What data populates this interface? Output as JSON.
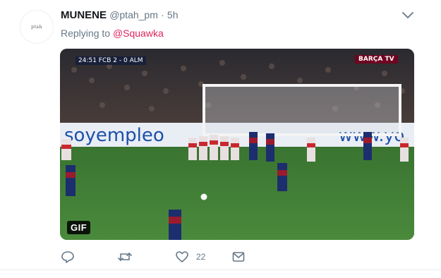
{
  "tweet": {
    "author_name": "MUNENE",
    "author_handle": "@ptah_pm",
    "separator": "·",
    "time": "5h",
    "avatar_text": "ptah",
    "replying_prefix": "Replying to",
    "replying_to": "@Squawka"
  },
  "media": {
    "badge": "GIF",
    "scorebug": "24:51  FCB 2 - 0 ALM",
    "channel_logo": "BARÇA TV",
    "ad_left": "soyempleo",
    "ad_right": "www.yo"
  },
  "actions": {
    "reply_icon": "reply-icon",
    "retweet_icon": "retweet-icon",
    "like_icon": "heart-icon",
    "like_count": "22",
    "dm_icon": "envelope-icon"
  },
  "colors": {
    "accent_red": "#e0245e",
    "text_gray": "#657786",
    "pitch_green": "#3f7a35"
  }
}
